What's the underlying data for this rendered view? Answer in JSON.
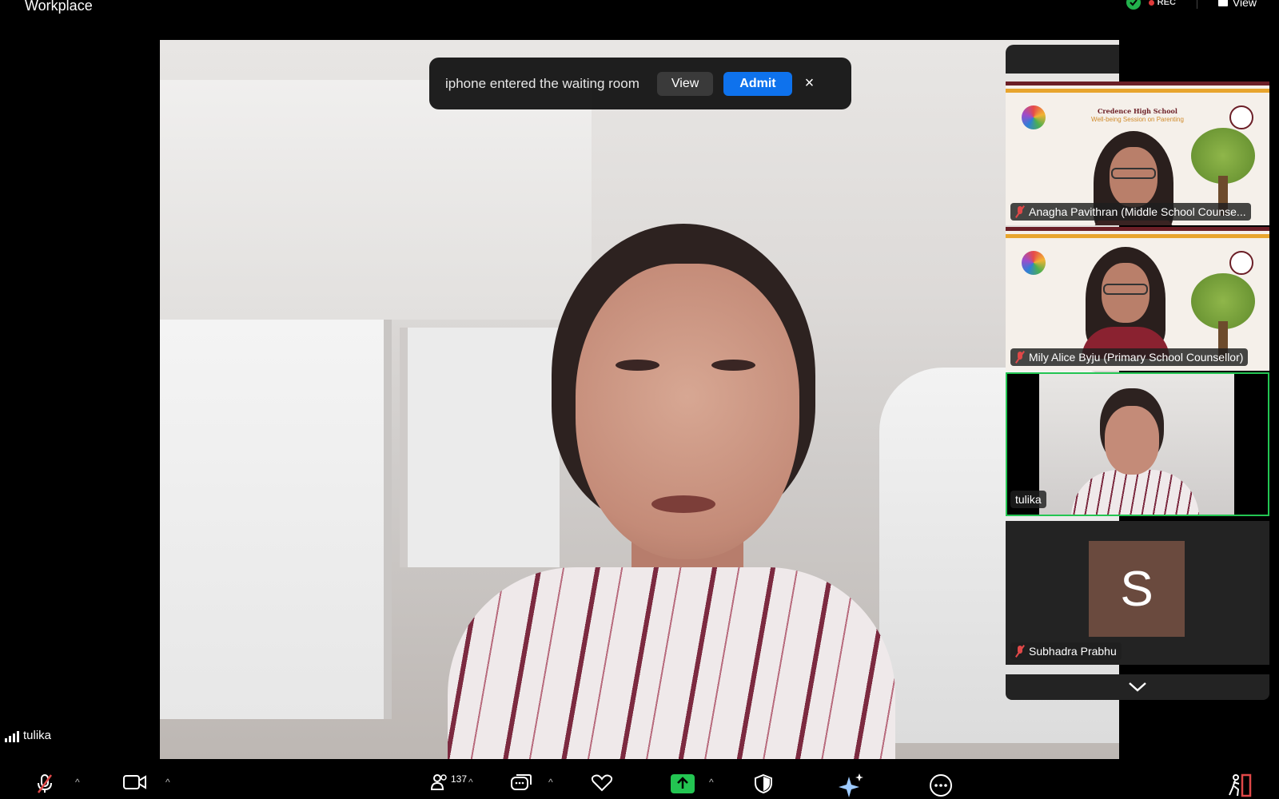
{
  "app": {
    "title": "Workplace"
  },
  "top_right": {
    "rec_label": "REC",
    "view_label": "View"
  },
  "notification": {
    "message": "iphone entered the waiting room",
    "view_label": "View",
    "admit_label": "Admit",
    "close_glyph": "×"
  },
  "main_video": {
    "speaker": "tulika"
  },
  "slide": {
    "school": "Credence High School",
    "session": "Well-being Session on Parenting"
  },
  "participants": [
    {
      "name": "Anagha Pavithran (Middle School Counse...",
      "muted": true
    },
    {
      "name": "Mily Alice Byju (Primary School Counsellor)",
      "muted": true
    },
    {
      "name": "tulika",
      "muted": false,
      "active_speaker": true
    },
    {
      "name": "Subhadra Prabhu",
      "muted": true,
      "avatar_letter": "S",
      "avatar_color": "#6a4a3e"
    }
  ],
  "local_user": {
    "name": "tulika"
  },
  "toolbar": {
    "participants_count": "137",
    "icons": [
      "mic-muted-icon",
      "video-camera-icon",
      "participants-icon",
      "chat-icon",
      "reactions-heart-icon",
      "share-screen-icon",
      "security-shield-icon",
      "ai-companion-icon",
      "more-icon",
      "leave-icon"
    ]
  },
  "colors": {
    "accent": "#0e72ed",
    "active_speaker": "#23c552",
    "muted": "#e04848",
    "share": "#23c552"
  }
}
